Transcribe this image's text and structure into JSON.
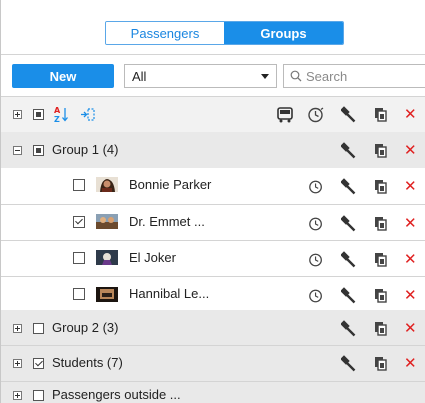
{
  "tabs": [
    {
      "label": "Passengers",
      "active": false
    },
    {
      "label": "Groups",
      "active": true
    }
  ],
  "toolbar": {
    "new_label": "New",
    "filter_value": "All",
    "search_placeholder": "Search"
  },
  "groups": [
    {
      "label": "Group 1 (4)",
      "expanded": true,
      "checked": "partial"
    },
    {
      "label": "Group 2 (3)",
      "expanded": false,
      "checked": false
    },
    {
      "label": "Students (7)",
      "expanded": false,
      "checked": true
    },
    {
      "label": "Passengers outside ...",
      "expanded": false,
      "checked": false
    }
  ],
  "passengers": [
    {
      "name": "Bonnie Parker",
      "checked": false
    },
    {
      "name": "Dr. Emmet ...",
      "checked": true
    },
    {
      "name": "El Joker",
      "checked": false
    },
    {
      "name": "Hannibal Le...",
      "checked": false
    }
  ],
  "colors": {
    "accent": "#1a8ee8",
    "delete": "#e02020",
    "group_row_bg": "#e9e9e9"
  }
}
